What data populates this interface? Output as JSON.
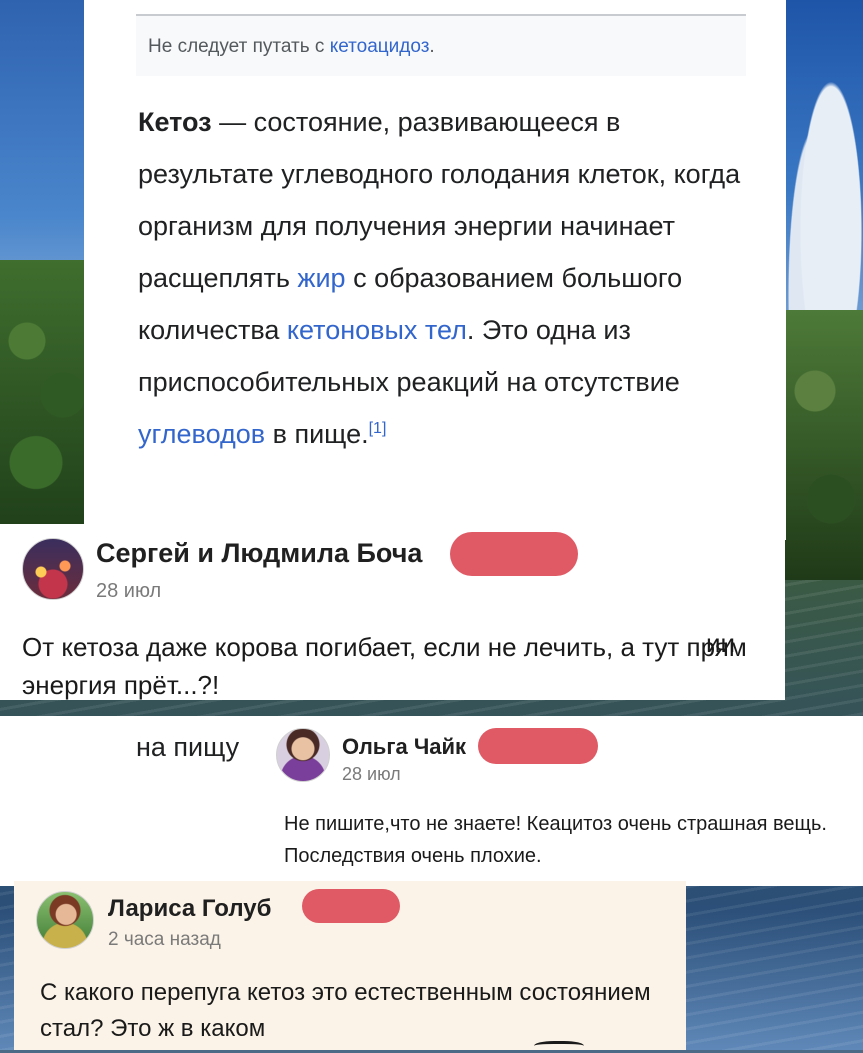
{
  "wiki": {
    "hatnote_prefix": "Не следует путать с ",
    "hatnote_link": "кетоацидоз",
    "hatnote_suffix": ".",
    "term": "Кетоз",
    "p1": " — состояние, развивающееся в результате углеводного голодания клеток, когда организм для получения энергии начинает расщеплять ",
    "link_fat": "жир",
    "p2": " с образованием большого количества ",
    "link_ketone": "кетоновых тел",
    "p3": ". Это одна из приспособительных реакций на отсутствие ",
    "link_carbs": "углеводов",
    "p4": " в пище.",
    "ref": "[1]"
  },
  "comments": [
    {
      "author": "Сергей и Людмила Боча",
      "time": "28 июл",
      "text": "От кетоза даже корова погибает, если не лечить, а тут прям энергия прёт...?!",
      "fragment": "ии"
    },
    {
      "background_fragment": "на пищу",
      "author": "Ольга Чайк",
      "time": "28 июл",
      "text": "Не пишите,что не знаете! Кеацитоз очень страшная вещь. Последствия очень плохие."
    },
    {
      "author": "Лариса Голуб",
      "time": "2 часа назад",
      "text": "С какого перепуга кетоз это естественным состоянием стал? Это ж в каком"
    }
  ],
  "colors": {
    "link": "#3366cc",
    "redaction": "#df5a64",
    "card_highlight": "#fbf3e7"
  }
}
